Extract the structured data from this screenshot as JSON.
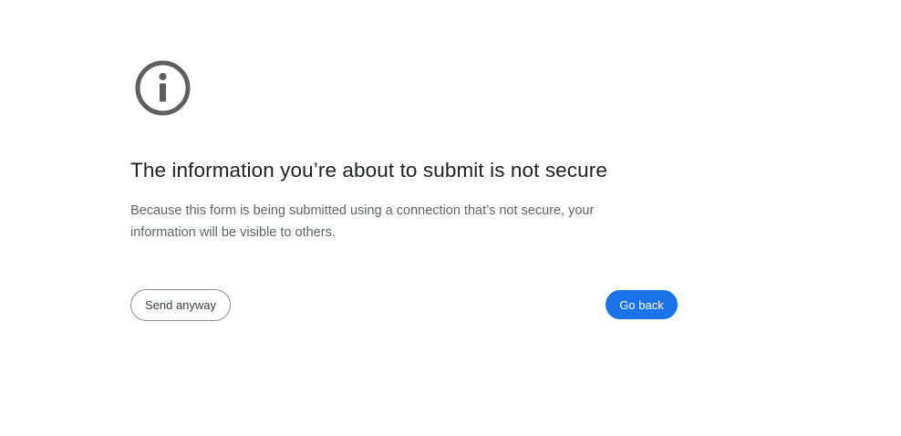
{
  "icon": "info-icon",
  "colors": {
    "icon": "#5f5f5f",
    "title": "#202124",
    "message": "#5f6368",
    "primary_button": "#1a73e8",
    "secondary_border": "#8a8d91"
  },
  "heading": "The information you’re about to submit is not secure",
  "message": "Because this form is being submitted using a connection that’s not secure, your information will be visible to others.",
  "buttons": {
    "send_anyway": "Send anyway",
    "go_back": "Go back"
  }
}
